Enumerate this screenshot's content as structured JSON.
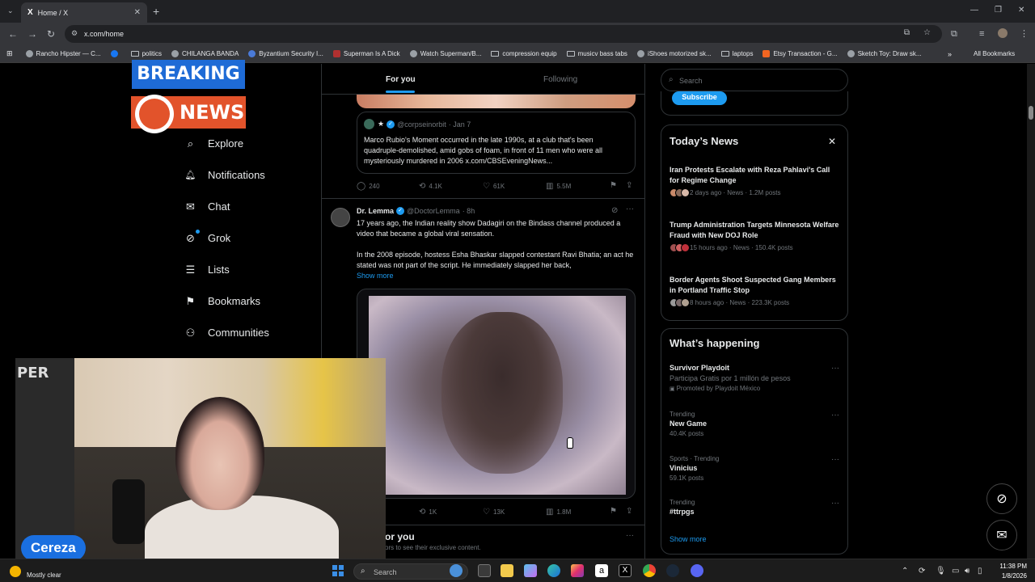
{
  "browser": {
    "tab_title": "Home / X",
    "tab_logo": "X",
    "tab_close": "✕",
    "new_tab": "+",
    "url": "x.com/home",
    "bookmarks": [
      {
        "label": "Rancho Hipster — C...",
        "icon": "globe-icon"
      },
      {
        "label": "",
        "icon": "facebook-icon"
      },
      {
        "label": "politics",
        "icon": "folder-icon"
      },
      {
        "label": "CHILANGA BANDA",
        "icon": "globe-icon"
      },
      {
        "label": "Byzantium Security I...",
        "icon": "bell-icon"
      },
      {
        "label": "Superman Is A Dick",
        "icon": "image-icon"
      },
      {
        "label": "Watch Superman/B...",
        "icon": "globe-icon"
      },
      {
        "label": "compression equip",
        "icon": "folder-icon"
      },
      {
        "label": "musicv bass tabs",
        "icon": "folder-icon"
      },
      {
        "label": "iShoes motorized sk...",
        "icon": "globe-icon"
      },
      {
        "label": "laptops",
        "icon": "folder-icon"
      },
      {
        "label": "Etsy Transaction - G...",
        "icon": "etsy-icon"
      },
      {
        "label": "Sketch Toy: Draw sk...",
        "icon": "globe-icon"
      }
    ],
    "all_bookmarks": "All Bookmarks"
  },
  "badges": {
    "breaking": "BREAKING",
    "news": "NEWS"
  },
  "nav": {
    "items": [
      {
        "label": "Explore",
        "icon": "search-icon",
        "glyph": "⌕"
      },
      {
        "label": "Notifications",
        "icon": "bell-icon",
        "glyph": "🔔"
      },
      {
        "label": "Chat",
        "icon": "mail-icon",
        "glyph": "✉"
      },
      {
        "label": "Grok",
        "icon": "grok-icon",
        "glyph": "⊘"
      },
      {
        "label": "Lists",
        "icon": "list-icon",
        "glyph": "☰"
      },
      {
        "label": "Bookmarks",
        "icon": "bookmark-icon",
        "glyph": "⚑"
      },
      {
        "label": "Communities",
        "icon": "people-icon",
        "glyph": "⚇"
      }
    ]
  },
  "feed": {
    "tabs": {
      "for_you": "For you",
      "following": "Following"
    },
    "quote": {
      "handle": "@corpseinorbit",
      "date": "· Jan 7",
      "text": "Marco Rubio's Moment occurred in the late 1990s, at a club that's been quadruple-demolished, amid gobs of foam, in front of 11 men who were all mysteriously murdered in 2006 x.com/CBSEveningNews..."
    },
    "tweet1_stats": {
      "replies": "240",
      "reposts": "4.1K",
      "likes": "61K",
      "views": "5.5M"
    },
    "tweet2": {
      "name": "Dr. Lemma",
      "handle": "@DoctorLemma",
      "time": "· 8h",
      "text1": "17 years ago, the Indian reality show Dadagiri on the Bindass channel produced a video that became a global viral sensation.",
      "text2": "In the 2008 episode, hostess Esha Bhaskar slapped contestant Ravi Bhatia; an act he stated was not part of the script. He immediately slapped her back,",
      "show_more": "Show more"
    },
    "tweet2_stats": {
      "reposts": "1K",
      "likes": "13K",
      "views": "1.8M"
    },
    "section_title": "or you",
    "section_sub": "ors to see their exclusive content."
  },
  "sidebar": {
    "search_placeholder": "Search",
    "subscribe": "Subscribe",
    "news_title": "Today’s News",
    "news": [
      {
        "headline": "Iran Protests Escalate with Reza Pahlavi's Call for Regime Change",
        "meta": "2 days ago · News · 1.2M posts"
      },
      {
        "headline": "Trump Administration Targets Minnesota Welfare Fraud with New DOJ Role",
        "meta": "15 hours ago · News · 150.4K posts"
      },
      {
        "headline": "Border Agents Shoot Suspected Gang Members in Portland Traffic Stop",
        "meta": "8 hours ago · News · 223.3K posts"
      }
    ],
    "happening_title": "What’s happening",
    "trends": [
      {
        "meta": "",
        "title": "Survivor Playdoit",
        "desc": "Participa Gratis por 1 millón de pesos",
        "sub": "Promoted by Playdoit México"
      },
      {
        "meta": "Trending",
        "title": "New Game",
        "desc": "",
        "sub": "40.4K posts"
      },
      {
        "meta": "Sports · Trending",
        "title": "Vinicius",
        "desc": "",
        "sub": "59.1K posts"
      },
      {
        "meta": "Trending",
        "title": "#ttrpgs",
        "desc": "",
        "sub": ""
      }
    ],
    "show_more": "Show more"
  },
  "webcam": {
    "name": "Cereza",
    "shelf_text": "PER"
  },
  "taskbar": {
    "weather": "Mostly clear",
    "search": "Search",
    "time": "11:38 PM",
    "date": "1/8/2026"
  }
}
